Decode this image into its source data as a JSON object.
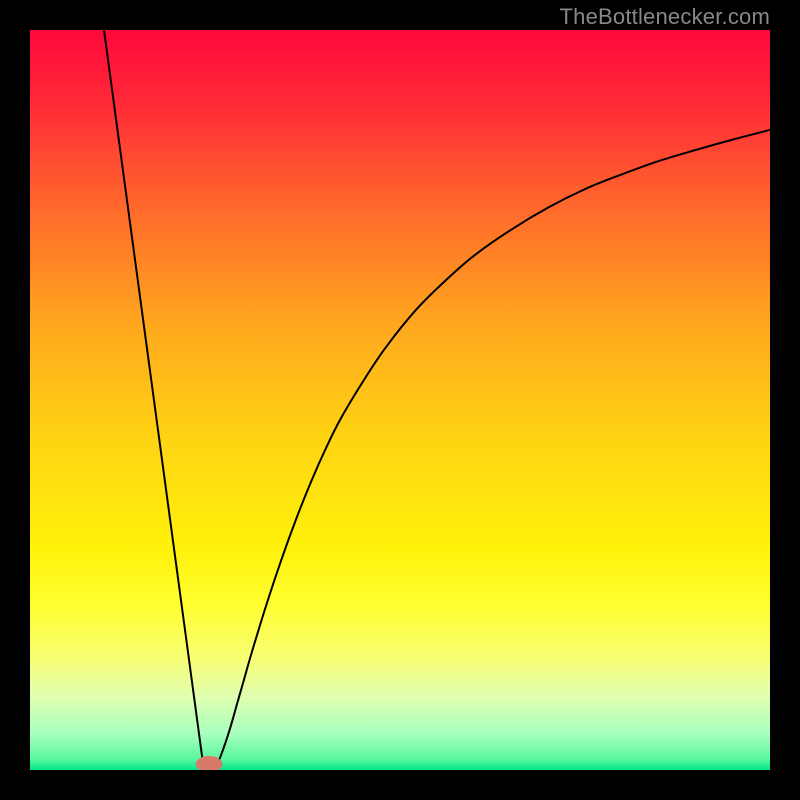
{
  "watermark": "TheBottlenecker.com",
  "chart_data": {
    "type": "line",
    "title": "",
    "xlabel": "",
    "ylabel": "",
    "xlim": [
      0,
      100
    ],
    "ylim": [
      0,
      100
    ],
    "grid": false,
    "background": "rainbow-vertical-gradient",
    "gradient_stops": [
      {
        "offset": 0.0,
        "color": "#ff083b"
      },
      {
        "offset": 0.1,
        "color": "#ff2a37"
      },
      {
        "offset": 0.25,
        "color": "#ff6d2b"
      },
      {
        "offset": 0.4,
        "color": "#ffa81e"
      },
      {
        "offset": 0.55,
        "color": "#ffd313"
      },
      {
        "offset": 0.7,
        "color": "#fff20a"
      },
      {
        "offset": 0.78,
        "color": "#ffff33"
      },
      {
        "offset": 0.85,
        "color": "#f8ff75"
      },
      {
        "offset": 0.9,
        "color": "#e1ffb0"
      },
      {
        "offset": 0.95,
        "color": "#a9ffbe"
      },
      {
        "offset": 0.985,
        "color": "#5cf7a0"
      },
      {
        "offset": 1.0,
        "color": "#00e58a"
      }
    ],
    "series": [
      {
        "name": "left-descent",
        "type": "line",
        "x": [
          10.0,
          23.5
        ],
        "y": [
          100.0,
          0.0
        ],
        "color": "#000000",
        "width": 2
      },
      {
        "name": "right-curve",
        "type": "line",
        "x": [
          25.0,
          26,
          27,
          28,
          29,
          30,
          32,
          34,
          36,
          38,
          40,
          42,
          45,
          48,
          52,
          56,
          60,
          65,
          70,
          75,
          80,
          85,
          90,
          95,
          100
        ],
        "y": [
          0.0,
          2.5,
          5.5,
          9.0,
          12.5,
          16.0,
          22.5,
          28.5,
          34.0,
          39.0,
          43.5,
          47.5,
          52.5,
          57.0,
          62.0,
          66.0,
          69.5,
          73.0,
          76.0,
          78.5,
          80.5,
          82.3,
          83.8,
          85.2,
          86.5
        ],
        "color": "#000000",
        "width": 2
      }
    ],
    "marker": {
      "name": "min-marker",
      "x": 24.2,
      "y": 0.8,
      "rx": 1.8,
      "ry": 1.1,
      "color": "#d67a6a"
    }
  }
}
